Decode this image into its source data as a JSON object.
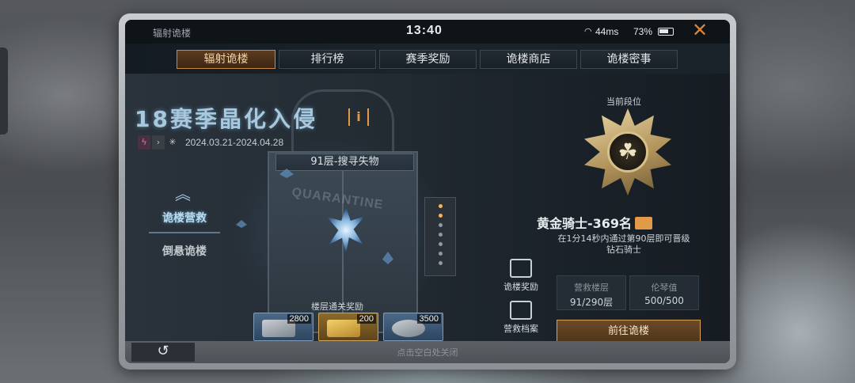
{
  "status_bar": {
    "app_name": "辐射诡楼",
    "time": "13:40",
    "ping": "44ms",
    "battery": "73%",
    "close_symbol": "✕"
  },
  "tabs": [
    {
      "label": "辐射诡楼",
      "active": true
    },
    {
      "label": "排行榜",
      "active": false
    },
    {
      "label": "赛季奖励",
      "active": false
    },
    {
      "label": "诡楼商店",
      "active": false
    },
    {
      "label": "诡楼密事",
      "active": false
    }
  ],
  "season": {
    "title": "18赛季晶化入侵",
    "info_label": "i",
    "dates": "2024.03.21-2024.04.28"
  },
  "scene": {
    "floor_label": "91层-搜寻失物",
    "door_stamp": "QUARANTINE"
  },
  "side_nav": {
    "up_arrow": "︽",
    "items": [
      {
        "label": "诡楼营救",
        "active": true
      },
      {
        "label": "倒悬诡楼",
        "active": false
      }
    ]
  },
  "rewards": {
    "caption": "楼层通关奖励",
    "items": [
      {
        "name": "cash-stack",
        "count": "2800"
      },
      {
        "name": "gold-bars",
        "count": "200"
      },
      {
        "name": "silver-ore",
        "count": "3500"
      }
    ]
  },
  "mid_buttons": {
    "rescue_rewards": "诡楼奖励",
    "rescue_archive": "营救档案"
  },
  "rank": {
    "caption": "当前段位",
    "name": "黄金骑士-369名",
    "promote_text": "在1分14秒内通过第90层即可晋级",
    "promote_target": "钻石骑士",
    "stats": [
      {
        "label": "营救楼层",
        "value": "91/290层"
      },
      {
        "label": "伦琴值",
        "value": "500/500"
      }
    ],
    "go_button": "前往诡楼"
  },
  "bottom": {
    "back_symbol": "↺",
    "hint": "点击空白处关闭"
  },
  "colors": {
    "accent_orange": "#d8843a",
    "title_blue": "#a8c8dd",
    "button_gold": "#d7a15a"
  }
}
